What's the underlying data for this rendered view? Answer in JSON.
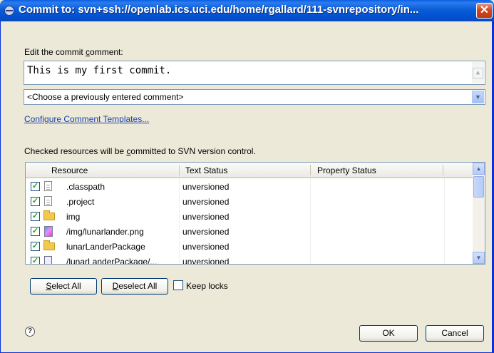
{
  "window": {
    "title": "Commit to: svn+ssh://openlab.ics.uci.edu/home/rgallard/111-svnrepository/in...",
    "close_glyph": "✕"
  },
  "comment": {
    "label_pre": "Edit the commit ",
    "label_access": "c",
    "label_post": "omment:",
    "value": "This is my first commit."
  },
  "previous": {
    "selected": "<Choose a previously entered comment>"
  },
  "templates_link": "Configure Comment Templates...",
  "resources": {
    "label_pre": "Checked resources will be ",
    "label_access": "c",
    "label_post": "ommitted to SVN version control.",
    "columns": [
      "Resource",
      "Text Status",
      "Property Status"
    ],
    "rows": [
      {
        "name": ".classpath",
        "status": "unversioned",
        "icon": "file-icon",
        "checked": true
      },
      {
        "name": ".project",
        "status": "unversioned",
        "icon": "file-icon",
        "checked": true
      },
      {
        "name": "img",
        "status": "unversioned",
        "icon": "folder-icon",
        "checked": true
      },
      {
        "name": "/img/lunarlander.png",
        "status": "unversioned",
        "icon": "image-file-icon",
        "checked": true
      },
      {
        "name": "lunarLanderPackage",
        "status": "unversioned",
        "icon": "folder-icon",
        "checked": true
      },
      {
        "name": "/lunarLanderPackage/...",
        "status": "unversioned",
        "icon": "java-file-icon",
        "checked": true
      }
    ]
  },
  "buttons": {
    "select_all": {
      "access": "S",
      "rest": "elect All"
    },
    "deselect_all": {
      "access": "D",
      "rest": "eselect All"
    },
    "keep_locks": "Keep locks",
    "ok": "OK",
    "cancel": "Cancel"
  }
}
